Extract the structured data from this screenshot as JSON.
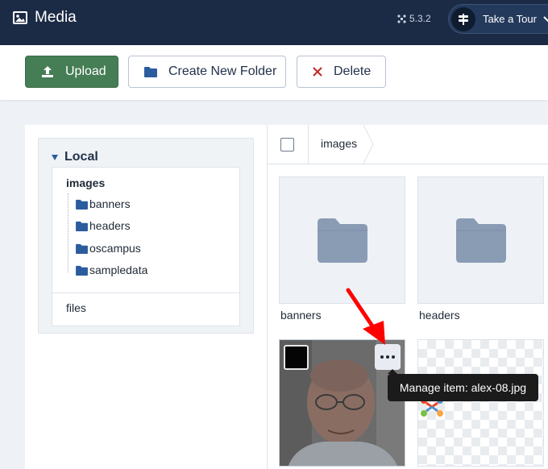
{
  "header": {
    "title": "Media",
    "title_icon": "image-icon",
    "version": "5.3.2",
    "version_icon": "joomla-icon",
    "tour_label": "Take a Tour",
    "tour_icon": "signpost-icon"
  },
  "toolbar": {
    "upload_label": "Upload",
    "create_folder_label": "Create New Folder",
    "delete_label": "Delete"
  },
  "tree": {
    "adapter_label": "Local",
    "root": "images",
    "children": [
      "banners",
      "headers",
      "oscampus",
      "sampledata"
    ],
    "files": "files"
  },
  "browser": {
    "breadcrumb": "images",
    "items": [
      {
        "name": "banners",
        "type": "folder"
      },
      {
        "name": "headers",
        "type": "folder"
      },
      {
        "name": "alex-08.jpg",
        "type": "image"
      },
      {
        "name": "",
        "type": "image"
      }
    ],
    "tooltip": "Manage item: alex-08.jpg"
  },
  "colors": {
    "header_bg": "#1c2b45",
    "upload_green": "#457d54",
    "delete_red": "#c52827",
    "folder_blue": "#2a5c9e",
    "folder_gray": "#8a9bb4",
    "annotation_arrow": "#ff0000"
  }
}
